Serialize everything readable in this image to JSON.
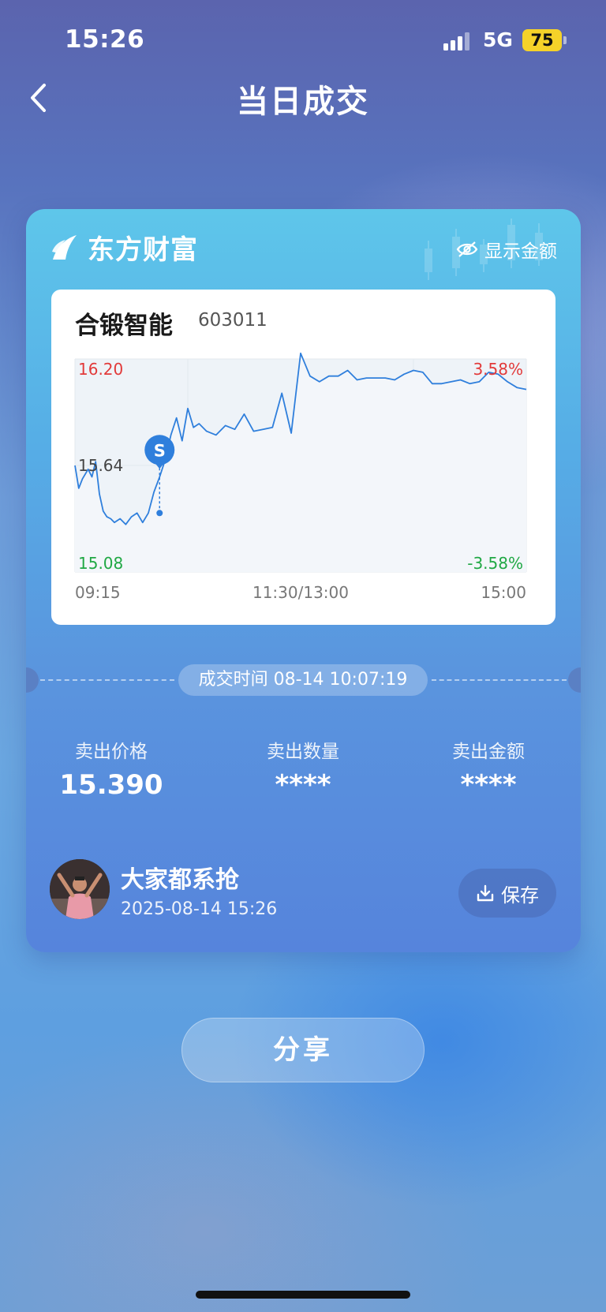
{
  "status_bar": {
    "time": "15:26",
    "network": "5G",
    "battery": "75"
  },
  "nav": {
    "title": "当日成交"
  },
  "card": {
    "brand": "东方财富",
    "show_amount_label": "显示金额",
    "stock": {
      "name": "合锻智能",
      "code": "603011"
    },
    "deal_time": "成交时间 08-14 10:07:19",
    "stats": [
      {
        "label": "卖出价格",
        "value": "15.390"
      },
      {
        "label": "卖出数量",
        "value": "****"
      },
      {
        "label": "卖出金额",
        "value": "****"
      }
    ],
    "user": {
      "name": "大家都系抢",
      "datetime": "2025-08-14 15:26"
    },
    "save_label": "保存"
  },
  "share_label": "分享",
  "chart_data": {
    "type": "line",
    "series": [
      {
        "x": [
          0,
          2,
          4,
          7,
          9,
          11,
          13,
          15,
          17,
          19,
          21,
          24,
          27,
          30,
          33,
          36,
          39,
          42,
          45,
          48,
          51,
          54,
          57,
          60,
          63,
          66,
          70,
          75,
          80,
          85,
          90,
          95,
          100,
          105,
          110,
          115,
          120,
          125,
          130,
          135,
          140,
          145,
          150,
          155,
          160,
          165,
          170,
          175,
          180,
          185,
          190,
          195,
          200,
          205,
          210,
          215,
          220,
          225,
          230,
          235,
          240
        ],
        "y": [
          15.64,
          15.52,
          15.57,
          15.62,
          15.58,
          15.66,
          15.49,
          15.4,
          15.37,
          15.36,
          15.34,
          15.36,
          15.33,
          15.37,
          15.39,
          15.34,
          15.39,
          15.5,
          15.58,
          15.67,
          15.8,
          15.89,
          15.77,
          15.94,
          15.84,
          15.86,
          15.82,
          15.8,
          15.85,
          15.83,
          15.91,
          15.82,
          15.83,
          15.84,
          16.02,
          15.81,
          16.23,
          16.11,
          16.08,
          16.11,
          16.11,
          16.14,
          16.09,
          16.1,
          16.1,
          16.1,
          16.09,
          16.12,
          16.14,
          16.13,
          16.07,
          16.07,
          16.08,
          16.09,
          16.07,
          16.08,
          16.13,
          16.12,
          16.08,
          16.05,
          16.04
        ]
      }
    ],
    "x_labels": [
      "09:15",
      "11:30/13:00",
      "15:00"
    ],
    "y_labels": {
      "high": "16.20",
      "mid": "15.64",
      "low": "15.08"
    },
    "pct_labels": {
      "high": "3.58%",
      "low": "-3.58%"
    },
    "marker": {
      "label": "S",
      "x": 45,
      "y": 15.39
    },
    "ylim": [
      15.08,
      16.2
    ],
    "xlim": [
      0,
      240
    ],
    "colors": {
      "line": "#2f7fdc",
      "up": "#e23a3a",
      "down": "#20a844",
      "grid": "#e3e8ee",
      "fill": "#eef3f8"
    }
  }
}
